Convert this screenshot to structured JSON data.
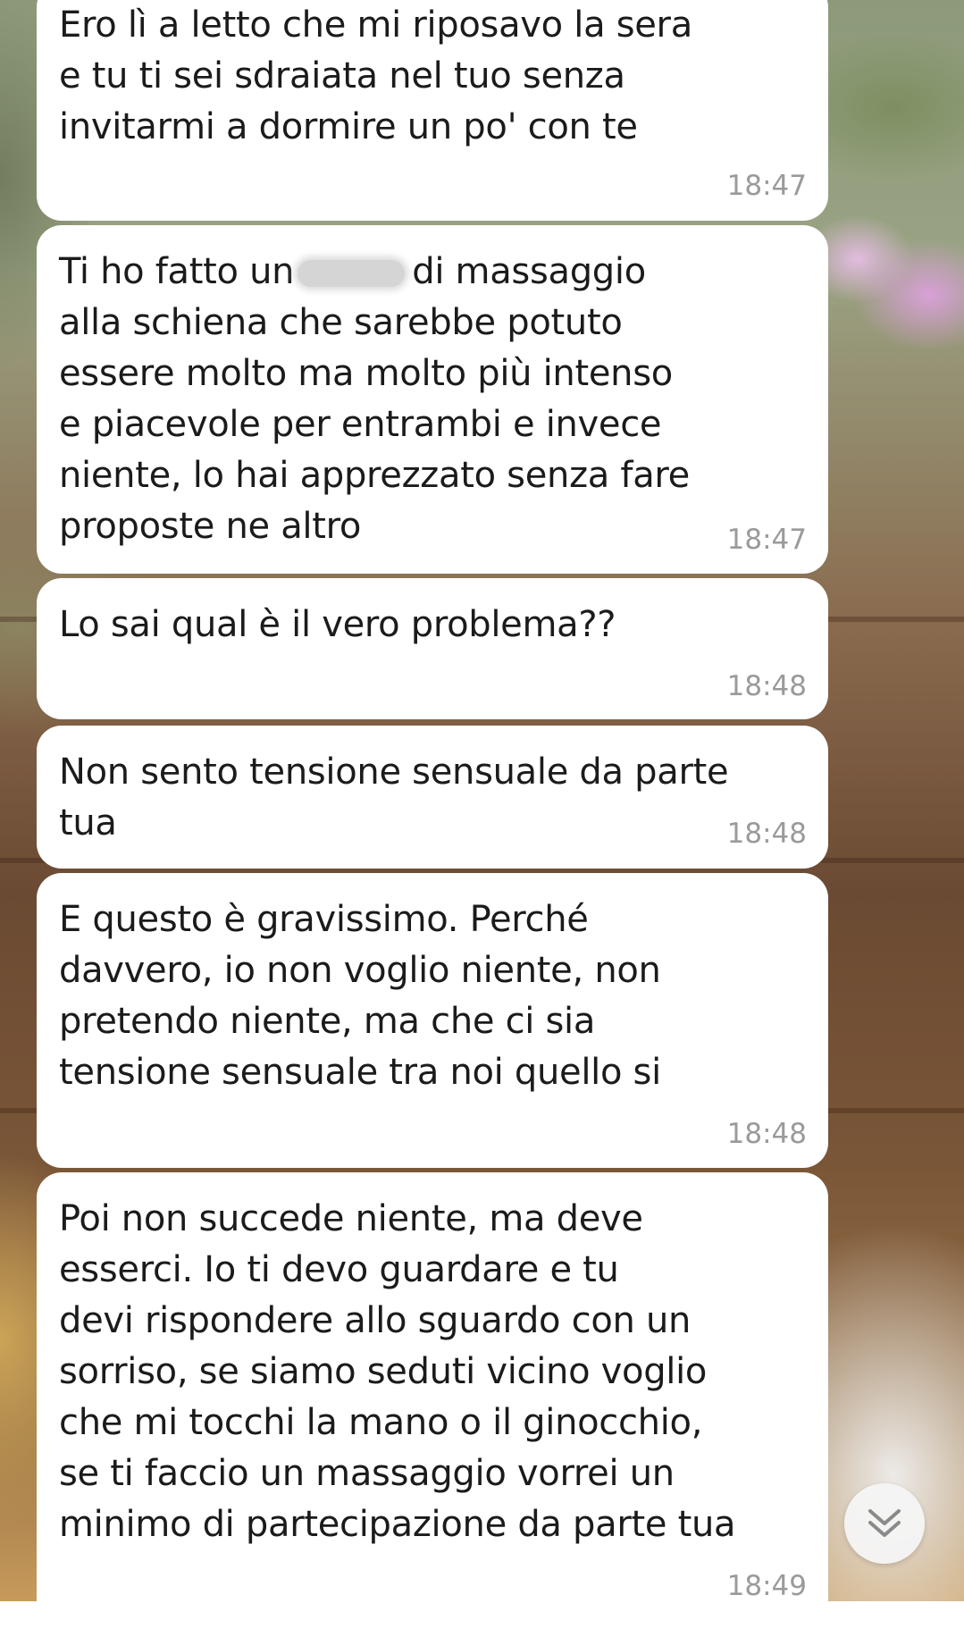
{
  "messages": [
    {
      "text": "Ero lì a letto che mi riposavo la sera\ne tu ti sei sdraiata nel tuo senza\ninvitarmi a dormire un po' con te",
      "time": "18:47"
    },
    {
      "text_a": "Ti ho fatto un",
      "text_b": "di massaggio\nalla schiena che sarebbe potuto\nessere molto ma molto più intenso\ne piacevole per entrambi e invece\nniente, lo hai apprezzato senza fare\nproposte ne altro",
      "time": "18:47"
    },
    {
      "text": "Lo sai qual è il vero problema??",
      "time": "18:48"
    },
    {
      "text": "Non sento tensione sensuale da parte\ntua",
      "time": "18:48"
    },
    {
      "text": "E questo è gravissimo. Perché\ndavvero, io non voglio niente, non\npretendo niente, ma che ci sia\ntensione sensuale tra noi quello si",
      "time": "18:48"
    },
    {
      "text": "Poi non succede niente, ma deve\nesserci. Io ti devo guardare e tu\ndevi rispondere allo sguardo con un\nsorriso, se siamo seduti vicino voglio\nche mi tocchi la mano o il ginocchio,\nse ti faccio un massaggio vorrei un\nminimo di partecipazione da parte tua",
      "time": "18:49"
    }
  ],
  "scroll_button": {
    "icon": "double-chevron-down-icon"
  }
}
